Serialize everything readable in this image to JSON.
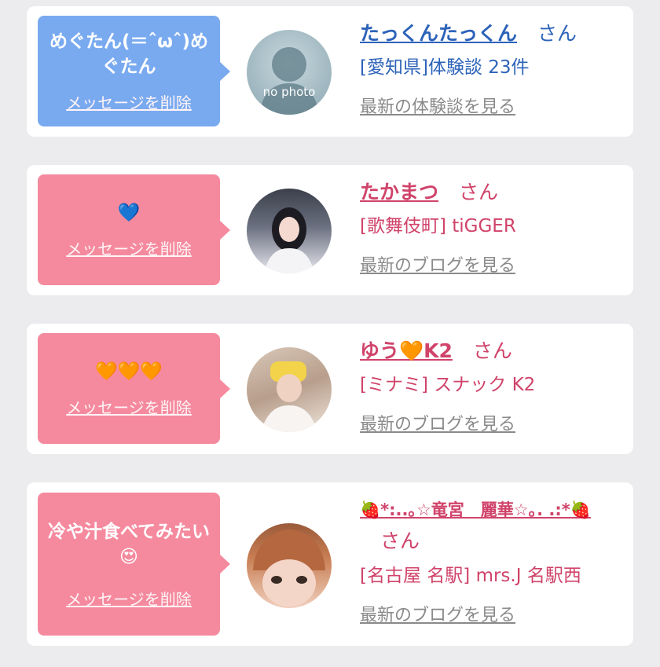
{
  "cards": [
    {
      "message": "めぐたん(＝ˆωˆ)めぐたん",
      "delete_label": "メッセージを削除",
      "avatar": "no-photo",
      "avatar_text": "no photo",
      "name": "たっくんたっくん",
      "honorific": "さん",
      "subtitle": "[愛知県]体験談 23件",
      "link": "最新の体験談を見る",
      "theme": "blue"
    },
    {
      "message": "💙",
      "delete_label": "メッセージを削除",
      "avatar": "photo",
      "name": "たかまつ",
      "honorific": "さん",
      "subtitle": "[歌舞伎町] tiGGER",
      "link": "最新のブログを見る",
      "theme": "pink"
    },
    {
      "message": "🧡🧡🧡",
      "delete_label": "メッセージを削除",
      "avatar": "photo",
      "name": "ゆう🧡K2",
      "honorific": "さん",
      "subtitle": "[ミナミ] スナック K2",
      "link": "最新のブログを見る",
      "theme": "pink"
    },
    {
      "message": "冷や汁食べてみたい😍",
      "delete_label": "メッセージを削除",
      "avatar": "photo",
      "name": "🍓*:..｡☆竜宮　麗華☆｡. .:*🍓",
      "honorific": "さん",
      "subtitle": "[名古屋 名駅] mrs.J 名駅西",
      "link": "最新のブログを見る",
      "theme": "pink"
    }
  ],
  "colors": {
    "blue_bubble": "#79aaf0",
    "pink_bubble": "#f58a9e",
    "blue_text": "#2d63b9",
    "pink_text": "#d0436a"
  }
}
